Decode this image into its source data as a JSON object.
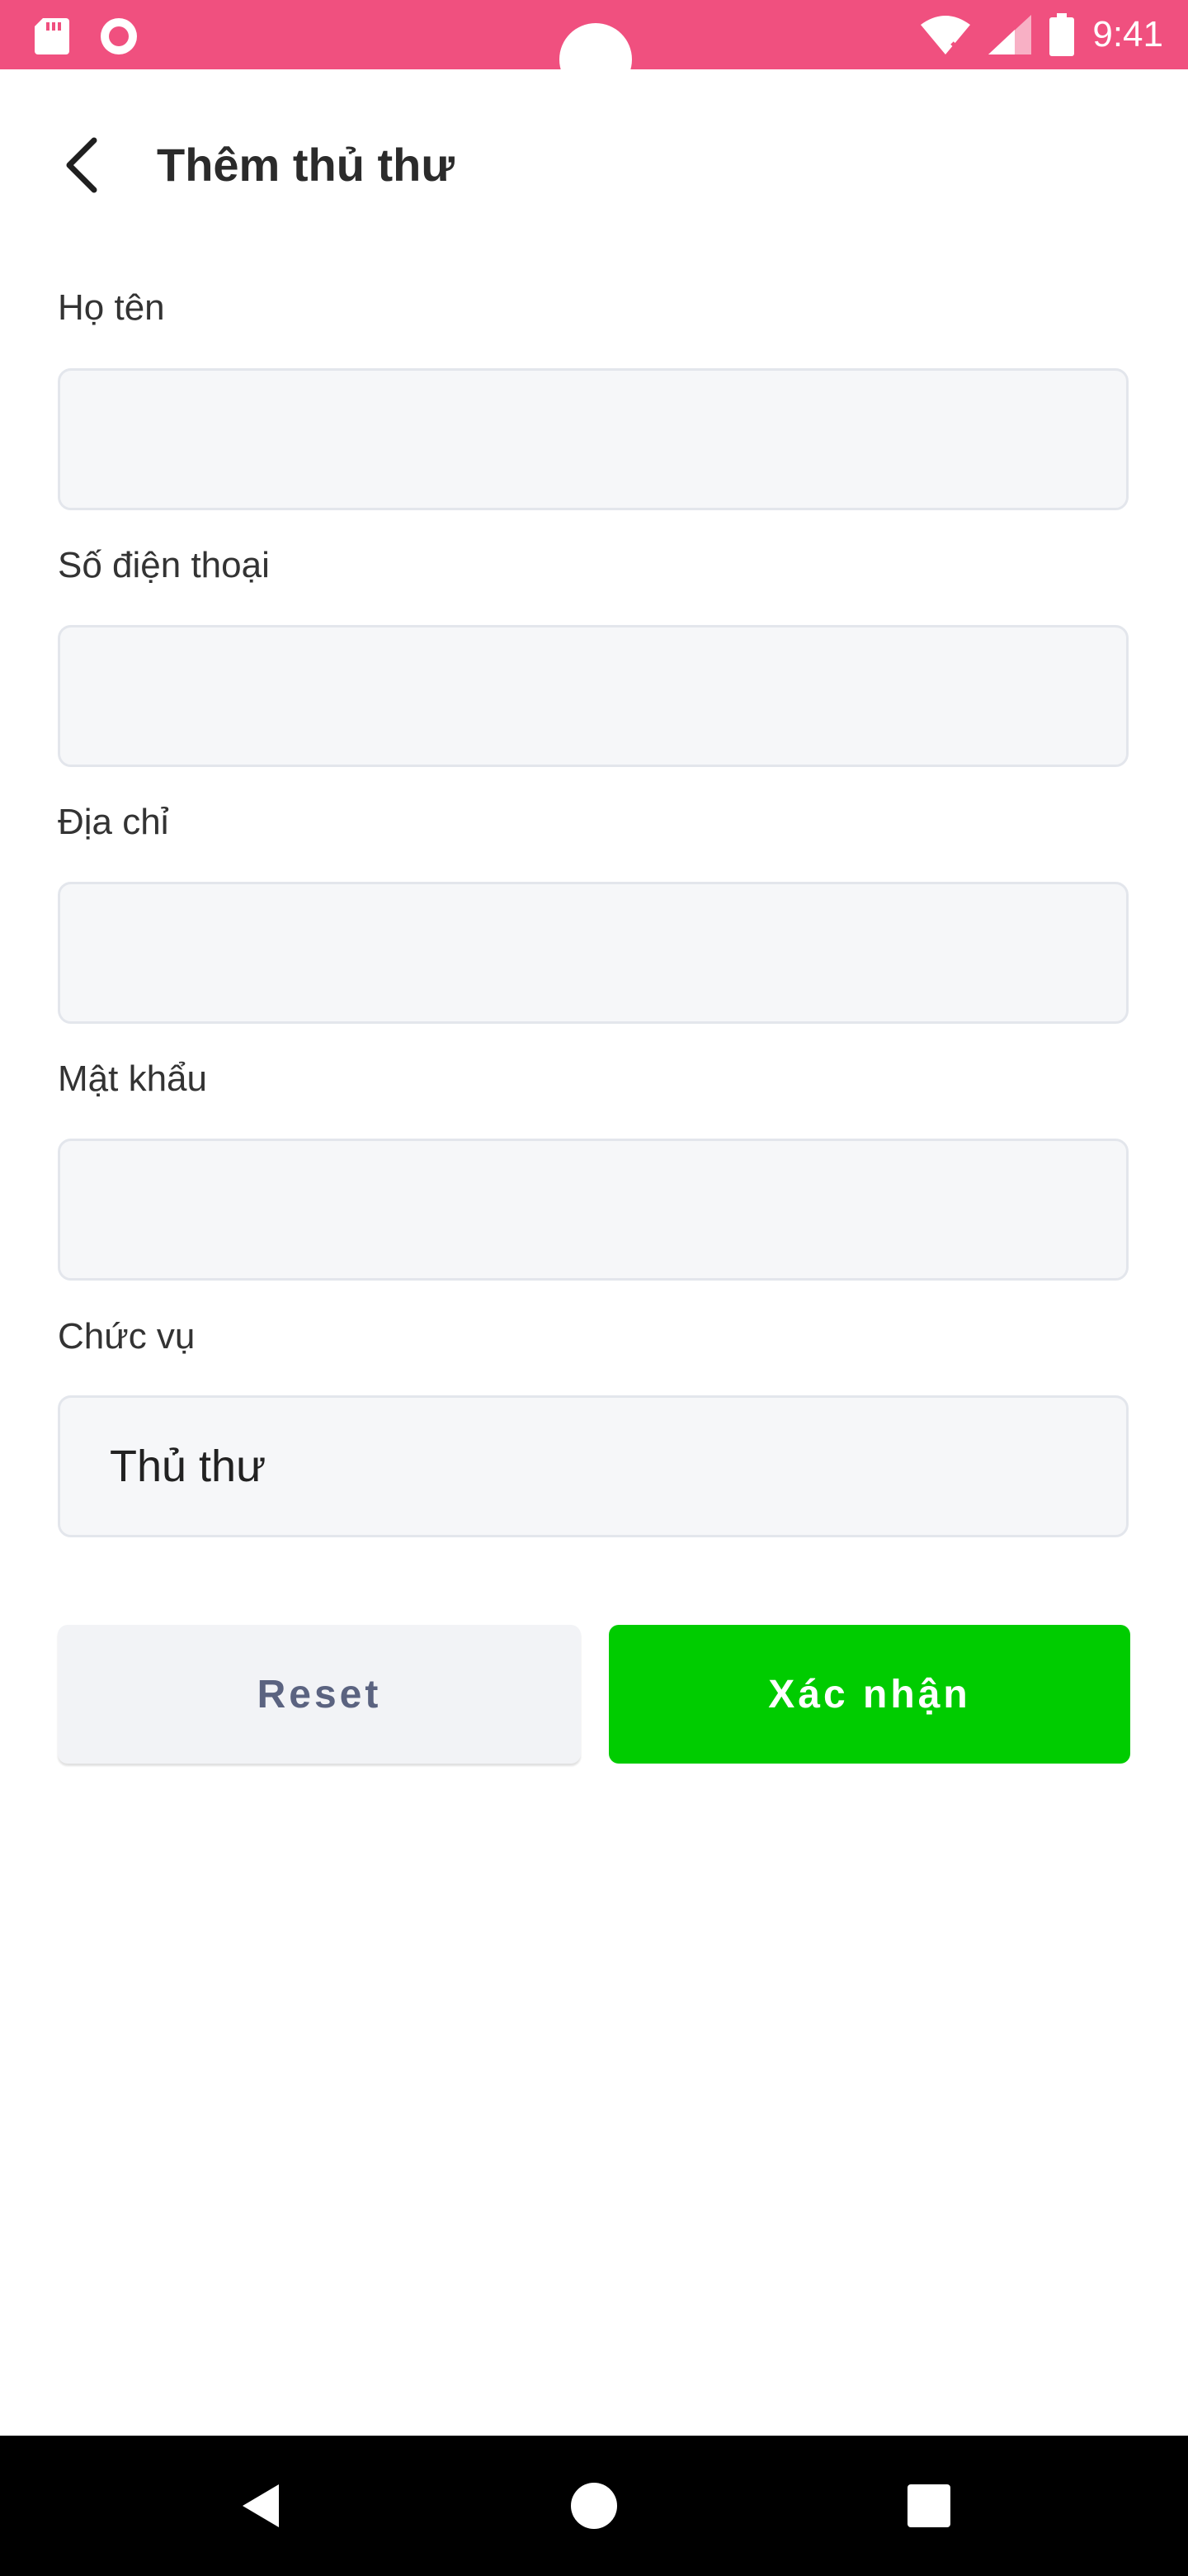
{
  "status_bar": {
    "time": "9:41",
    "background_color": "#f0507f",
    "icons": [
      "sd-card-icon",
      "record-icon",
      "wifi-icon",
      "signal-icon",
      "battery-icon"
    ]
  },
  "header": {
    "title": "Thêm thủ thư",
    "back_icon": "arrow-back-icon"
  },
  "form": {
    "fields": [
      {
        "label": "Họ tên",
        "value": ""
      },
      {
        "label": "Số điện thoại",
        "value": ""
      },
      {
        "label": "Địa chỉ",
        "value": ""
      },
      {
        "label": "Mật khẩu",
        "value": ""
      },
      {
        "label": "Chức vụ",
        "value": "Thủ thư"
      }
    ]
  },
  "actions": {
    "reset_label": "Reset",
    "confirm_label": "Xác nhận",
    "confirm_color": "#00cc00"
  },
  "nav_bar": {
    "icons": [
      "nav-back-icon",
      "nav-home-icon",
      "nav-recents-icon"
    ]
  }
}
